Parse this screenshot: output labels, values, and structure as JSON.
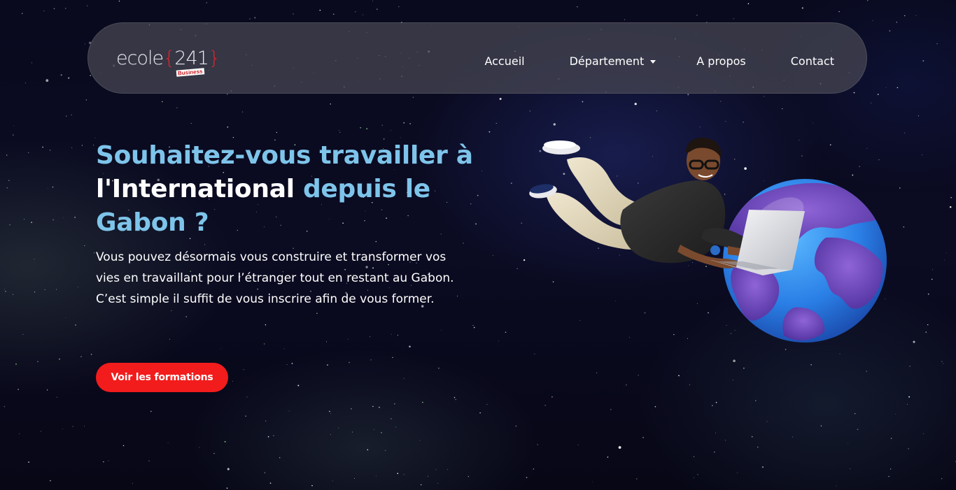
{
  "brand": {
    "logo_word": "ecole",
    "logo_number": "241",
    "logo_sub": "Business",
    "accent_color": "#e2252b"
  },
  "nav": {
    "items": [
      {
        "label": "Accueil"
      },
      {
        "label": "Département",
        "has_dropdown": true
      },
      {
        "label": "A propos"
      },
      {
        "label": "Contact"
      }
    ]
  },
  "hero": {
    "title_part1": "Souhaitez-vous travailler à ",
    "title_highlight": "l'International",
    "title_part2": " depuis le Gabon ?",
    "title_color": "#7ec4ea",
    "description_lines": [
      "Vous pouvez désormais vous construire et transformer vos vies en travaillant pour l’étranger tout en restant au Gabon.",
      "C’est simple il suffit de vous inscrire afin de vous former."
    ],
    "cta_label": "Voir les formations",
    "cta_color": "#f21c1c"
  },
  "illustration": {
    "icon": "floating-person-laptop-globe-illustration"
  }
}
